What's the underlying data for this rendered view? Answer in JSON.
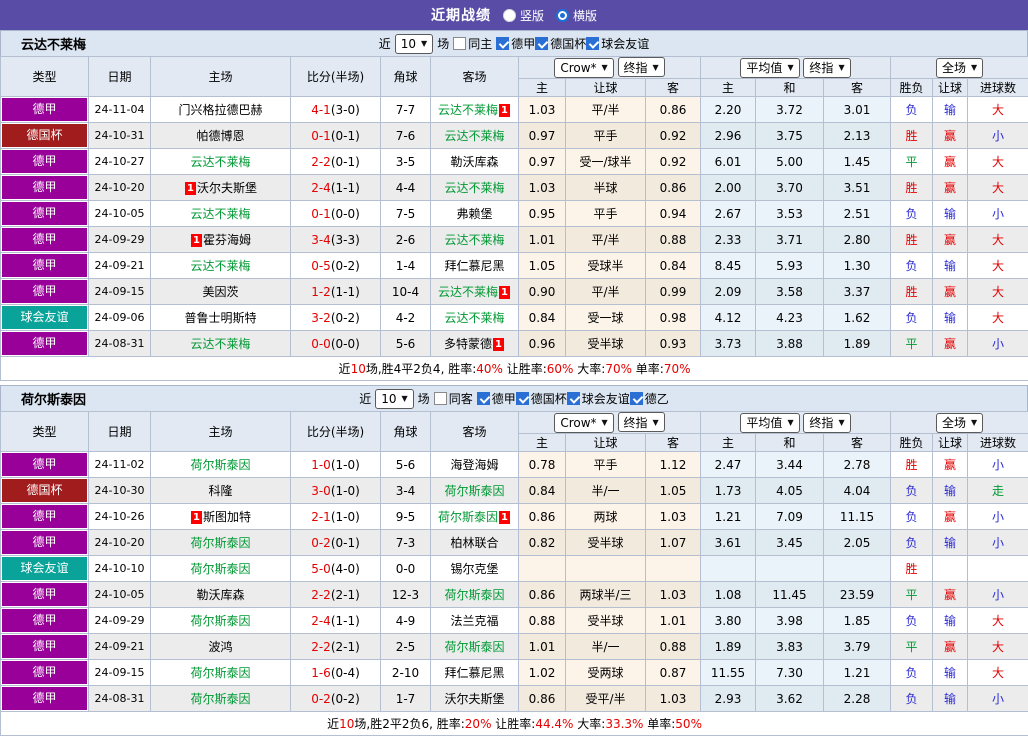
{
  "title_bar": {
    "title": "近期战绩",
    "view_options": [
      {
        "label": "竖版",
        "checked": false
      },
      {
        "label": "横版",
        "checked": true
      }
    ]
  },
  "header": {
    "left_cols": [
      "类型",
      "日期",
      "主场",
      "比分(半场)",
      "角球",
      "客场"
    ],
    "provider_select": "Crow*",
    "provider_time_select": "终指",
    "odds_cols": [
      "主",
      "让球",
      "客"
    ],
    "avg_select": "平均值",
    "avg_time_select": "终指",
    "avg_cols": [
      "主",
      "和",
      "客"
    ],
    "scope_select": "全场",
    "result_cols": [
      "胜负",
      "让球",
      "进球数"
    ]
  },
  "colors": {
    "titlebar_bg": "#584ca7",
    "league_bundesliga": "#990099",
    "league_cup": "#a11c1c",
    "league_friendly": "#0aa39a",
    "highlight_team_green": "#009933",
    "score_red": "#e60000",
    "win_red": "#e60000",
    "draw_green": "#009933",
    "lose_blue": "#2b2bd5",
    "odds_col_bg": "#fcf3e9",
    "avg_col_bg": "#e9f3f9"
  },
  "sections": [
    {
      "team": "云达不莱梅",
      "filter": {
        "recent_label": "近",
        "recent_count": "10",
        "matches_label": "场",
        "same_label": "同主",
        "same_checked": false,
        "leagues": [
          {
            "label": "德甲",
            "checked": true
          },
          {
            "label": "德国杯",
            "checked": true
          },
          {
            "label": "球会友谊",
            "checked": true
          }
        ]
      },
      "rows": [
        {
          "type": "德甲",
          "date": "24-11-04",
          "home": "门兴格拉德巴赫",
          "home_self": false,
          "home_badge": "",
          "score": "4-1",
          "half": "(3-0)",
          "corner": "7-7",
          "away": "云达不莱梅",
          "away_self": true,
          "away_badge": "1",
          "odds": [
            "1.03",
            "平/半",
            "0.86"
          ],
          "avg": [
            "2.20",
            "3.72",
            "3.01"
          ],
          "res": [
            {
              "t": "负",
              "c": "b"
            },
            {
              "t": "输",
              "c": "b"
            },
            {
              "t": "大",
              "c": "r"
            }
          ]
        },
        {
          "type": "德国杯",
          "date": "24-10-31",
          "home": "帕德博恩",
          "home_self": false,
          "home_badge": "",
          "score": "0-1",
          "half": "(0-1)",
          "corner": "7-6",
          "away": "云达不莱梅",
          "away_self": true,
          "away_badge": "",
          "odds": [
            "0.97",
            "平手",
            "0.92"
          ],
          "avg": [
            "2.96",
            "3.75",
            "2.13"
          ],
          "res": [
            {
              "t": "胜",
              "c": "r"
            },
            {
              "t": "赢",
              "c": "r"
            },
            {
              "t": "小",
              "c": "b"
            }
          ]
        },
        {
          "type": "德甲",
          "date": "24-10-27",
          "home": "云达不莱梅",
          "home_self": true,
          "home_badge": "",
          "score": "2-2",
          "half": "(0-1)",
          "corner": "3-5",
          "away": "勒沃库森",
          "away_self": false,
          "away_badge": "",
          "odds": [
            "0.97",
            "受一/球半",
            "0.92"
          ],
          "avg": [
            "6.01",
            "5.00",
            "1.45"
          ],
          "res": [
            {
              "t": "平",
              "c": "g"
            },
            {
              "t": "赢",
              "c": "r"
            },
            {
              "t": "大",
              "c": "r"
            }
          ]
        },
        {
          "type": "德甲",
          "date": "24-10-20",
          "home": "沃尔夫斯堡",
          "home_self": false,
          "home_badge": "1",
          "score": "2-4",
          "half": "(1-1)",
          "corner": "4-4",
          "away": "云达不莱梅",
          "away_self": true,
          "away_badge": "",
          "odds": [
            "1.03",
            "半球",
            "0.86"
          ],
          "avg": [
            "2.00",
            "3.70",
            "3.51"
          ],
          "res": [
            {
              "t": "胜",
              "c": "r"
            },
            {
              "t": "赢",
              "c": "r"
            },
            {
              "t": "大",
              "c": "r"
            }
          ]
        },
        {
          "type": "德甲",
          "date": "24-10-05",
          "home": "云达不莱梅",
          "home_self": true,
          "home_badge": "",
          "score": "0-1",
          "half": "(0-0)",
          "corner": "7-5",
          "away": "弗赖堡",
          "away_self": false,
          "away_badge": "",
          "odds": [
            "0.95",
            "平手",
            "0.94"
          ],
          "avg": [
            "2.67",
            "3.53",
            "2.51"
          ],
          "res": [
            {
              "t": "负",
              "c": "b"
            },
            {
              "t": "输",
              "c": "b"
            },
            {
              "t": "小",
              "c": "b"
            }
          ]
        },
        {
          "type": "德甲",
          "date": "24-09-29",
          "home": "霍芬海姆",
          "home_self": false,
          "home_badge": "1",
          "score": "3-4",
          "half": "(3-3)",
          "corner": "2-6",
          "away": "云达不莱梅",
          "away_self": true,
          "away_badge": "",
          "odds": [
            "1.01",
            "平/半",
            "0.88"
          ],
          "avg": [
            "2.33",
            "3.71",
            "2.80"
          ],
          "res": [
            {
              "t": "胜",
              "c": "r"
            },
            {
              "t": "赢",
              "c": "r"
            },
            {
              "t": "大",
              "c": "r"
            }
          ]
        },
        {
          "type": "德甲",
          "date": "24-09-21",
          "home": "云达不莱梅",
          "home_self": true,
          "home_badge": "",
          "score": "0-5",
          "half": "(0-2)",
          "corner": "1-4",
          "away": "拜仁慕尼黑",
          "away_self": false,
          "away_badge": "",
          "odds": [
            "1.05",
            "受球半",
            "0.84"
          ],
          "avg": [
            "8.45",
            "5.93",
            "1.30"
          ],
          "res": [
            {
              "t": "负",
              "c": "b"
            },
            {
              "t": "输",
              "c": "b"
            },
            {
              "t": "大",
              "c": "r"
            }
          ]
        },
        {
          "type": "德甲",
          "date": "24-09-15",
          "home": "美因茨",
          "home_self": false,
          "home_badge": "",
          "score": "1-2",
          "half": "(1-1)",
          "corner": "10-4",
          "away": "云达不莱梅",
          "away_self": true,
          "away_badge": "1",
          "odds": [
            "0.90",
            "平/半",
            "0.99"
          ],
          "avg": [
            "2.09",
            "3.58",
            "3.37"
          ],
          "res": [
            {
              "t": "胜",
              "c": "r"
            },
            {
              "t": "赢",
              "c": "r"
            },
            {
              "t": "大",
              "c": "r"
            }
          ]
        },
        {
          "type": "球会友谊",
          "date": "24-09-06",
          "home": "普鲁士明斯特",
          "home_self": false,
          "home_badge": "",
          "score": "3-2",
          "half": "(0-2)",
          "corner": "4-2",
          "away": "云达不莱梅",
          "away_self": true,
          "away_badge": "",
          "odds": [
            "0.84",
            "受一球",
            "0.98"
          ],
          "avg": [
            "4.12",
            "4.23",
            "1.62"
          ],
          "res": [
            {
              "t": "负",
              "c": "b"
            },
            {
              "t": "输",
              "c": "b"
            },
            {
              "t": "大",
              "c": "r"
            }
          ]
        },
        {
          "type": "德甲",
          "date": "24-08-31",
          "home": "云达不莱梅",
          "home_self": true,
          "home_badge": "",
          "score": "0-0",
          "half": "(0-0)",
          "corner": "5-6",
          "away": "多特蒙德",
          "away_self": false,
          "away_badge": "1",
          "odds": [
            "0.96",
            "受半球",
            "0.93"
          ],
          "avg": [
            "3.73",
            "3.88",
            "1.89"
          ],
          "res": [
            {
              "t": "平",
              "c": "g"
            },
            {
              "t": "赢",
              "c": "r"
            },
            {
              "t": "小",
              "c": "b"
            }
          ]
        }
      ],
      "summary": [
        {
          "t": "近",
          "c": "k"
        },
        {
          "t": "10",
          "c": "r"
        },
        {
          "t": "场,胜4平2负4, 胜率:",
          "c": "k"
        },
        {
          "t": "40%",
          "c": "r"
        },
        {
          "t": " 让胜率:",
          "c": "k"
        },
        {
          "t": "60%",
          "c": "r"
        },
        {
          "t": " 大率:",
          "c": "k"
        },
        {
          "t": "70%",
          "c": "r"
        },
        {
          "t": " 单率:",
          "c": "k"
        },
        {
          "t": "70%",
          "c": "r"
        }
      ]
    },
    {
      "team": "荷尔斯泰因",
      "filter": {
        "recent_label": "近",
        "recent_count": "10",
        "matches_label": "场",
        "same_label": "同客",
        "same_checked": false,
        "leagues": [
          {
            "label": "德甲",
            "checked": true
          },
          {
            "label": "德国杯",
            "checked": true
          },
          {
            "label": "球会友谊",
            "checked": true
          },
          {
            "label": "德乙",
            "checked": true
          }
        ]
      },
      "rows": [
        {
          "type": "德甲",
          "date": "24-11-02",
          "home": "荷尔斯泰因",
          "home_self": true,
          "home_badge": "",
          "score": "1-0",
          "half": "(1-0)",
          "corner": "5-6",
          "away": "海登海姆",
          "away_self": false,
          "away_badge": "",
          "odds": [
            "0.78",
            "平手",
            "1.12"
          ],
          "avg": [
            "2.47",
            "3.44",
            "2.78"
          ],
          "res": [
            {
              "t": "胜",
              "c": "r"
            },
            {
              "t": "赢",
              "c": "r"
            },
            {
              "t": "小",
              "c": "b"
            }
          ]
        },
        {
          "type": "德国杯",
          "date": "24-10-30",
          "home": "科隆",
          "home_self": false,
          "home_badge": "",
          "score": "3-0",
          "half": "(1-0)",
          "corner": "3-4",
          "away": "荷尔斯泰因",
          "away_self": true,
          "away_badge": "",
          "odds": [
            "0.84",
            "半/一",
            "1.05"
          ],
          "avg": [
            "1.73",
            "4.05",
            "4.04"
          ],
          "res": [
            {
              "t": "负",
              "c": "b"
            },
            {
              "t": "输",
              "c": "b"
            },
            {
              "t": "走",
              "c": "g"
            }
          ]
        },
        {
          "type": "德甲",
          "date": "24-10-26",
          "home": "斯图加特",
          "home_self": false,
          "home_badge": "1",
          "score": "2-1",
          "half": "(1-0)",
          "corner": "9-5",
          "away": "荷尔斯泰因",
          "away_self": true,
          "away_badge": "1",
          "odds": [
            "0.86",
            "两球",
            "1.03"
          ],
          "avg": [
            "1.21",
            "7.09",
            "11.15"
          ],
          "res": [
            {
              "t": "负",
              "c": "b"
            },
            {
              "t": "赢",
              "c": "r"
            },
            {
              "t": "小",
              "c": "b"
            }
          ]
        },
        {
          "type": "德甲",
          "date": "24-10-20",
          "home": "荷尔斯泰因",
          "home_self": true,
          "home_badge": "",
          "score": "0-2",
          "half": "(0-1)",
          "corner": "7-3",
          "away": "柏林联合",
          "away_self": false,
          "away_badge": "",
          "odds": [
            "0.82",
            "受半球",
            "1.07"
          ],
          "avg": [
            "3.61",
            "3.45",
            "2.05"
          ],
          "res": [
            {
              "t": "负",
              "c": "b"
            },
            {
              "t": "输",
              "c": "b"
            },
            {
              "t": "小",
              "c": "b"
            }
          ]
        },
        {
          "type": "球会友谊",
          "date": "24-10-10",
          "home": "荷尔斯泰因",
          "home_self": true,
          "home_badge": "",
          "score": "5-0",
          "half": "(4-0)",
          "corner": "0-0",
          "away": "锡尔克堡",
          "away_self": false,
          "away_badge": "",
          "odds": [
            "",
            "",
            ""
          ],
          "avg": [
            "",
            "",
            ""
          ],
          "res": [
            {
              "t": "胜",
              "c": "r"
            },
            {
              "t": "",
              "c": ""
            },
            {
              "t": "",
              "c": ""
            }
          ]
        },
        {
          "type": "德甲",
          "date": "24-10-05",
          "home": "勒沃库森",
          "home_self": false,
          "home_badge": "",
          "score": "2-2",
          "half": "(2-1)",
          "corner": "12-3",
          "away": "荷尔斯泰因",
          "away_self": true,
          "away_badge": "",
          "odds": [
            "0.86",
            "两球半/三",
            "1.03"
          ],
          "avg": [
            "1.08",
            "11.45",
            "23.59"
          ],
          "res": [
            {
              "t": "平",
              "c": "g"
            },
            {
              "t": "赢",
              "c": "r"
            },
            {
              "t": "小",
              "c": "b"
            }
          ]
        },
        {
          "type": "德甲",
          "date": "24-09-29",
          "home": "荷尔斯泰因",
          "home_self": true,
          "home_badge": "",
          "score": "2-4",
          "half": "(1-1)",
          "corner": "4-9",
          "away": "法兰克福",
          "away_self": false,
          "away_badge": "",
          "odds": [
            "0.88",
            "受半球",
            "1.01"
          ],
          "avg": [
            "3.80",
            "3.98",
            "1.85"
          ],
          "res": [
            {
              "t": "负",
              "c": "b"
            },
            {
              "t": "输",
              "c": "b"
            },
            {
              "t": "大",
              "c": "r"
            }
          ]
        },
        {
          "type": "德甲",
          "date": "24-09-21",
          "home": "波鸿",
          "home_self": false,
          "home_badge": "",
          "score": "2-2",
          "half": "(2-1)",
          "corner": "2-5",
          "away": "荷尔斯泰因",
          "away_self": true,
          "away_badge": "",
          "odds": [
            "1.01",
            "半/一",
            "0.88"
          ],
          "avg": [
            "1.89",
            "3.83",
            "3.79"
          ],
          "res": [
            {
              "t": "平",
              "c": "g"
            },
            {
              "t": "赢",
              "c": "r"
            },
            {
              "t": "大",
              "c": "r"
            }
          ]
        },
        {
          "type": "德甲",
          "date": "24-09-15",
          "home": "荷尔斯泰因",
          "home_self": true,
          "home_badge": "",
          "score": "1-6",
          "half": "(0-4)",
          "corner": "2-10",
          "away": "拜仁慕尼黑",
          "away_self": false,
          "away_badge": "",
          "odds": [
            "1.02",
            "受两球",
            "0.87"
          ],
          "avg": [
            "11.55",
            "7.30",
            "1.21"
          ],
          "res": [
            {
              "t": "负",
              "c": "b"
            },
            {
              "t": "输",
              "c": "b"
            },
            {
              "t": "大",
              "c": "r"
            }
          ]
        },
        {
          "type": "德甲",
          "date": "24-08-31",
          "home": "荷尔斯泰因",
          "home_self": true,
          "home_badge": "",
          "score": "0-2",
          "half": "(0-2)",
          "corner": "1-7",
          "away": "沃尔夫斯堡",
          "away_self": false,
          "away_badge": "",
          "odds": [
            "0.86",
            "受平/半",
            "1.03"
          ],
          "avg": [
            "2.93",
            "3.62",
            "2.28"
          ],
          "res": [
            {
              "t": "负",
              "c": "b"
            },
            {
              "t": "输",
              "c": "b"
            },
            {
              "t": "小",
              "c": "b"
            }
          ]
        }
      ],
      "summary": [
        {
          "t": "近",
          "c": "k"
        },
        {
          "t": "10",
          "c": "r"
        },
        {
          "t": "场,胜2平2负6, 胜率:",
          "c": "k"
        },
        {
          "t": "20%",
          "c": "r"
        },
        {
          "t": " 让胜率:",
          "c": "k"
        },
        {
          "t": "44.4%",
          "c": "r"
        },
        {
          "t": " 大率:",
          "c": "k"
        },
        {
          "t": "33.3%",
          "c": "r"
        },
        {
          "t": " 单率:",
          "c": "k"
        },
        {
          "t": "50%",
          "c": "r"
        }
      ]
    }
  ]
}
